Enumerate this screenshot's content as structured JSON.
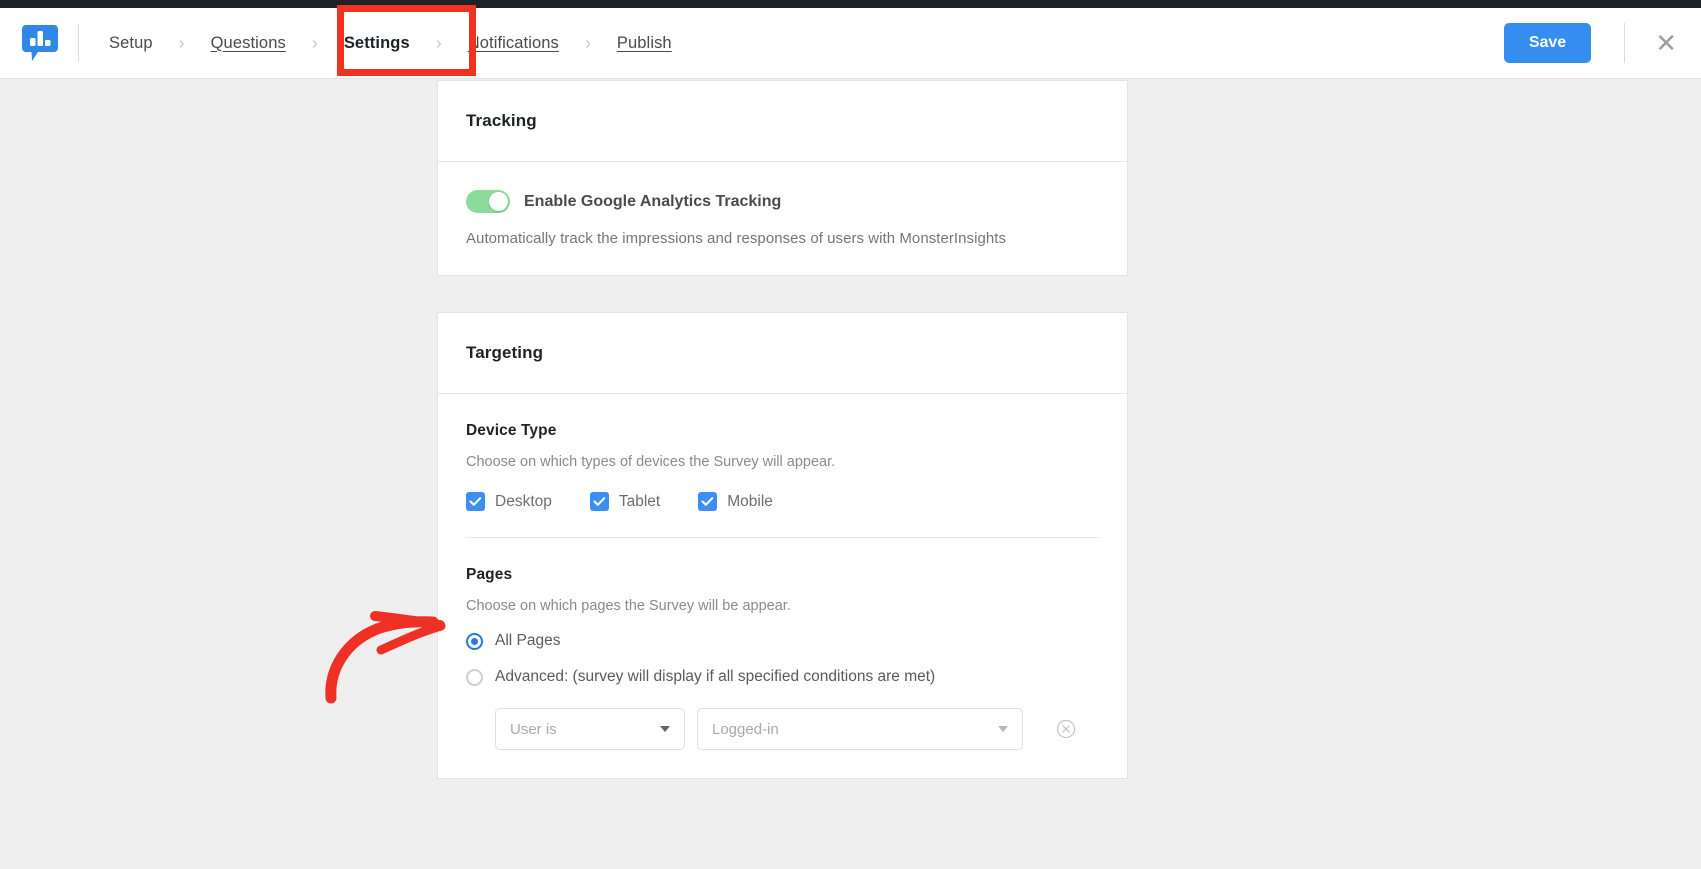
{
  "app": {
    "logo_icon": "survey-bar-chart-bubble-icon"
  },
  "header": {
    "steps": [
      {
        "label": "Setup",
        "state": "plain"
      },
      {
        "label": "Questions",
        "state": "link"
      },
      {
        "label": "Settings",
        "state": "active"
      },
      {
        "label": "Notifications",
        "state": "link"
      },
      {
        "label": "Publish",
        "state": "link"
      }
    ],
    "separator": "›",
    "save_label": "Save",
    "close_icon": "close-icon",
    "close_glyph": "✕"
  },
  "tracking": {
    "title": "Tracking",
    "toggle": {
      "label": "Enable Google Analytics Tracking",
      "enabled": true
    },
    "description": "Automatically track the impressions and responses of users with MonsterInsights"
  },
  "targeting": {
    "title": "Targeting",
    "device_type": {
      "title": "Device Type",
      "description": "Choose on which types of devices the Survey will appear.",
      "options": [
        {
          "label": "Desktop",
          "checked": true
        },
        {
          "label": "Tablet",
          "checked": true
        },
        {
          "label": "Mobile",
          "checked": true
        }
      ]
    },
    "pages": {
      "title": "Pages",
      "description": "Choose on which pages the Survey will be appear.",
      "options": [
        {
          "label": "All Pages",
          "selected": true
        },
        {
          "label": "Advanced: (survey will display if all specified conditions are met)",
          "selected": false
        }
      ],
      "condition": {
        "subject_value": "User is",
        "state_value": "Logged-in",
        "remove_icon": "remove-condition-icon"
      }
    }
  },
  "annotations": {
    "settings_highlight_color": "#f0321f",
    "arrow_color": "#ee3124",
    "arrow_target": "Pages"
  },
  "colors": {
    "accent_blue": "#338ef0",
    "toggle_green": "#8ddb9b",
    "page_background": "#efefef",
    "admin_bar": "#1d2327"
  }
}
